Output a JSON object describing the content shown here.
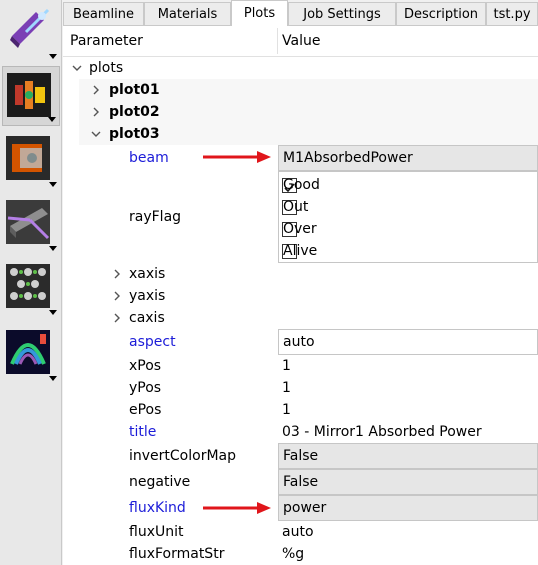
{
  "toolbar": {
    "buttons": [
      {
        "name": "source",
        "icon": "source-icon"
      },
      {
        "name": "optics",
        "icon": "optics-icon"
      },
      {
        "name": "screen",
        "icon": "screen-icon"
      },
      {
        "name": "mirror",
        "icon": "mirror-icon"
      },
      {
        "name": "crystal",
        "icon": "crystal-icon"
      },
      {
        "name": "plot",
        "icon": "plot-icon"
      }
    ]
  },
  "tabs": [
    "Beamline",
    "Materials",
    "Plots",
    "Job Settings",
    "Description",
    "tst.py"
  ],
  "active_tab": "Plots",
  "header": {
    "parameter": "Parameter",
    "value": "Value"
  },
  "tree": {
    "root": "plots",
    "plot01": "plot01",
    "plot02": "plot02",
    "plot03": "plot03",
    "beam": {
      "label": "beam",
      "value": "M1AbsorbedPower"
    },
    "rayFlag": {
      "label": "rayFlag",
      "options": [
        {
          "label": "Good",
          "checked": true
        },
        {
          "label": "Out",
          "checked": false
        },
        {
          "label": "Over",
          "checked": false
        },
        {
          "label": "Alive",
          "checked": false
        }
      ]
    },
    "xaxis": "xaxis",
    "yaxis": "yaxis",
    "caxis": "caxis",
    "aspect": {
      "label": "aspect",
      "value": "auto"
    },
    "xPos": {
      "label": "xPos",
      "value": "1"
    },
    "yPos": {
      "label": "yPos",
      "value": "1"
    },
    "ePos": {
      "label": "ePos",
      "value": "1"
    },
    "title": {
      "label": "title",
      "value": "03 - Mirror1 Absorbed Power"
    },
    "invertColorMap": {
      "label": "invertColorMap",
      "value": "False"
    },
    "negative": {
      "label": "negative",
      "value": "False"
    },
    "fluxKind": {
      "label": "fluxKind",
      "value": "power"
    },
    "fluxUnit": {
      "label": "fluxUnit",
      "value": "auto"
    },
    "fluxFormatStr": {
      "label": "fluxFormatStr",
      "value": "%g"
    }
  },
  "colors": {
    "modified_label": "#1c1cd8",
    "annotation_arrow": "#e0161b"
  }
}
